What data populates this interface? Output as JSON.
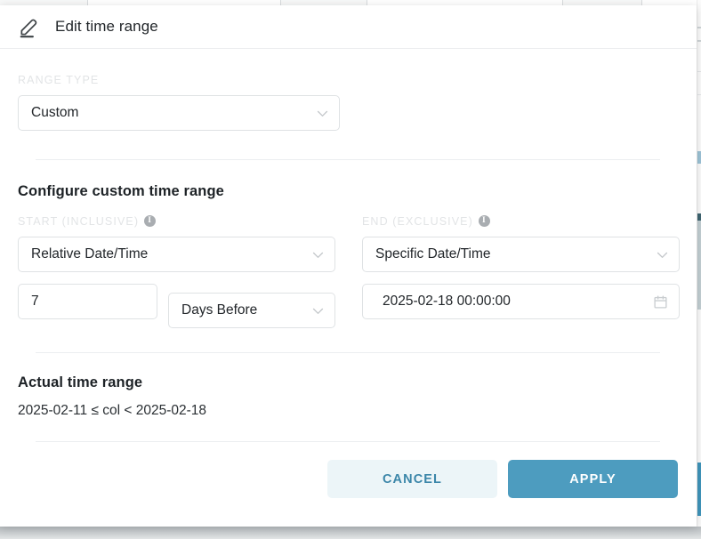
{
  "colors": {
    "accent": "#4d9cbf",
    "accent_soft": "#ecf5f8",
    "accent_text": "#3b86a9",
    "text": "#22262a",
    "label": "#e2e4e6",
    "border": "#dfe2e4",
    "divider": "#eceef0"
  },
  "modal": {
    "title": "Edit time range",
    "title_icon": "pencil-edit-icon"
  },
  "range_type": {
    "label": "RANGE TYPE",
    "value": "Custom",
    "chevron_icon": "chevron-down-icon"
  },
  "custom_section": {
    "title": "Configure custom time range",
    "start": {
      "label": "START (INCLUSIVE)",
      "info_icon": "info-icon",
      "info_glyph": "i",
      "type_value": "Relative Date/Time",
      "amount_value": "7",
      "unit_value": "Days Before"
    },
    "end": {
      "label": "END (EXCLUSIVE)",
      "info_icon": "info-icon",
      "info_glyph": "i",
      "type_value": "Specific Date/Time",
      "datetime_value": "2025-02-18 00:00:00",
      "calendar_icon": "calendar-icon"
    }
  },
  "actual_range": {
    "title": "Actual time range",
    "expression": "2025-02-11 ≤ col < 2025-02-18"
  },
  "footer": {
    "cancel_label": "CANCEL",
    "apply_label": "APPLY"
  }
}
